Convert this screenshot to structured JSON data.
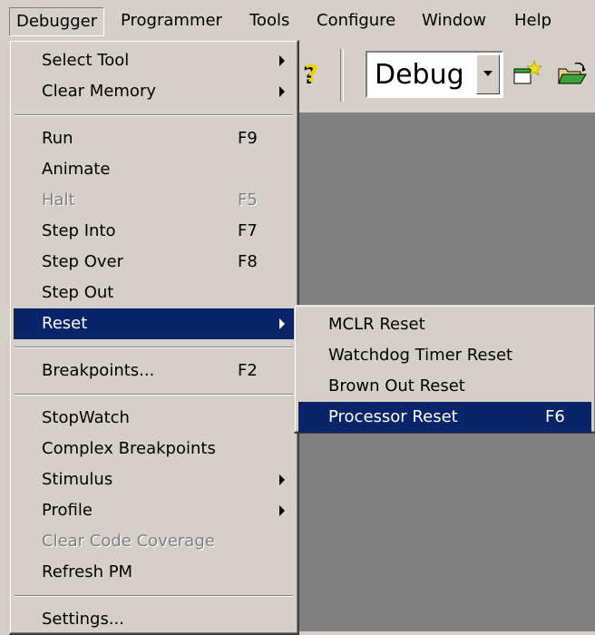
{
  "menubar": {
    "items": [
      "Debugger",
      "Programmer",
      "Tools",
      "Configure",
      "Window",
      "Help"
    ]
  },
  "toolbar": {
    "configuration_value": "Debug"
  },
  "debugger_menu": {
    "select_tool": "Select Tool",
    "clear_memory": "Clear Memory",
    "run": "Run",
    "run_key": "F9",
    "animate": "Animate",
    "halt": "Halt",
    "halt_key": "F5",
    "step_into": "Step Into",
    "step_into_key": "F7",
    "step_over": "Step Over",
    "step_over_key": "F8",
    "step_out": "Step Out",
    "reset": "Reset",
    "breakpoints": "Breakpoints...",
    "breakpoints_key": "F2",
    "stopwatch": "StopWatch",
    "complex_breakpoints": "Complex Breakpoints",
    "stimulus": "Stimulus",
    "profile": "Profile",
    "clear_code_coverage": "Clear Code Coverage",
    "refresh_pm": "Refresh PM",
    "settings": "Settings..."
  },
  "reset_submenu": {
    "mclr_reset": "MCLR Reset",
    "watchdog_timer_reset": "Watchdog Timer Reset",
    "brown_out_reset": "Brown Out Reset",
    "processor_reset": "Processor Reset",
    "processor_reset_key": "F6"
  },
  "colors": {
    "face": "#d4d0c8",
    "highlight": "#0a246a",
    "workspace": "#808080"
  }
}
